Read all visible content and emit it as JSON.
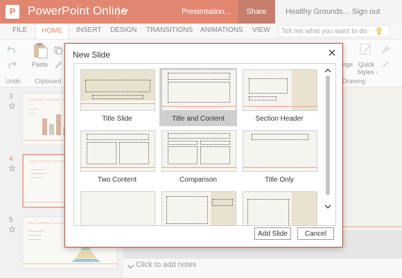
{
  "app": {
    "logo_letter": "P",
    "name": "PowerPoint Online",
    "doc_title": "Presentation...",
    "share_label": "Share",
    "account_label": "Healthy Grounds...",
    "signout_label": "Sign out",
    "brand_color": "#d24726"
  },
  "ribbon": {
    "tabs": [
      {
        "label": "FILE"
      },
      {
        "label": "HOME",
        "active": true
      },
      {
        "label": "INSERT"
      },
      {
        "label": "DESIGN"
      },
      {
        "label": "TRANSITIONS"
      },
      {
        "label": "ANIMATIONS"
      },
      {
        "label": "VIEW"
      }
    ],
    "tell_me_placeholder": "Tell me what you want to do",
    "paste_label": "Paste",
    "undo_group": "Undo",
    "clipboard_group": "Clipboard",
    "drawing_group": "Drawing",
    "arrange_label": "nge",
    "quick_styles_label1": "Quick",
    "quick_styles_label2": "Styles -"
  },
  "slides_panel": {
    "slides": [
      {
        "number": "3",
        "title": "TITLE AND CONTENT LAYOUT"
      },
      {
        "number": "4",
        "title": "TWO CONTENT LAYOUT",
        "selected": true
      },
      {
        "number": "5",
        "title": "TWO CONTENT LAYOUT"
      }
    ]
  },
  "notes_placeholder": "Click to add notes",
  "dialog": {
    "title": "New Slide",
    "layouts": [
      {
        "name": "Title Slide"
      },
      {
        "name": "Title and Content",
        "selected": true
      },
      {
        "name": "Section Header"
      },
      {
        "name": "Two Content"
      },
      {
        "name": "Comparison"
      },
      {
        "name": "Title Only"
      },
      {
        "name": ""
      },
      {
        "name": ""
      },
      {
        "name": ""
      }
    ],
    "add_label": "Add Slide",
    "cancel_label": "Cancel"
  }
}
